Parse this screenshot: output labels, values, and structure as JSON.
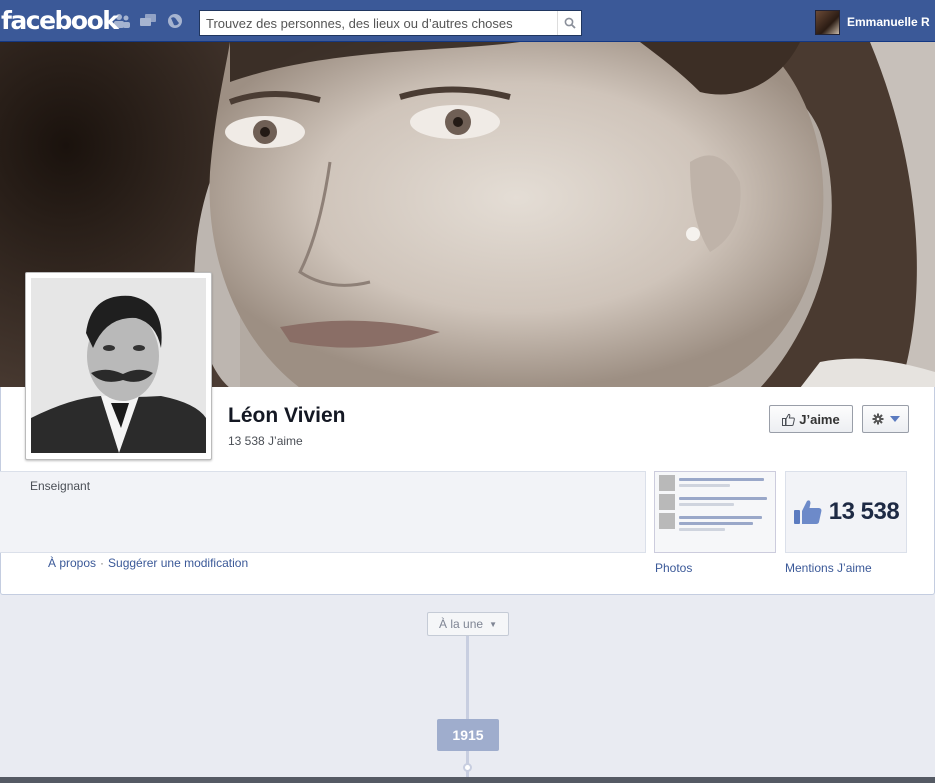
{
  "topbar": {
    "logo": "facebook",
    "search_placeholder": "Trouvez des personnes, des lieux ou d’autres choses",
    "user_name": "Emmanuelle R"
  },
  "page": {
    "name": "Léon Vivien",
    "likes_line": "13 538 J’aime",
    "like_button": "J’aime",
    "category": "Enseignant",
    "about_link": "À propos",
    "separator": "·",
    "suggest_link": "Suggérer une modification",
    "photos_label": "Photos",
    "likes_big": "13 538",
    "likes_label": "Mentions J’aime"
  },
  "timeline": {
    "filter_label": "À la une",
    "year": "1915"
  },
  "colors": {
    "brand": "#3b5998",
    "background": "#e9ebf2"
  }
}
